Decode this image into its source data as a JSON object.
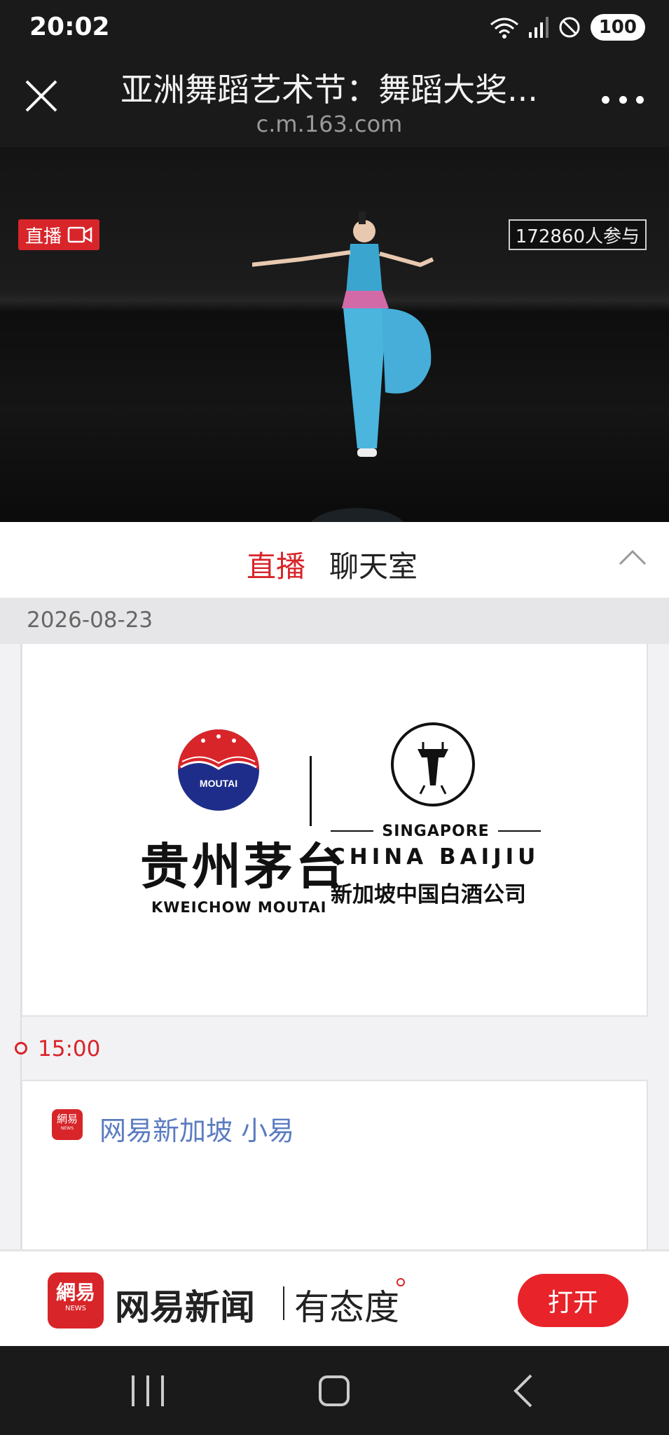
{
  "status_bar": {
    "time": "20:02",
    "network": "6E",
    "battery": "100",
    "icons": [
      "wifi-icon",
      "signal-icon",
      "do-not-disturb-icon",
      "battery-icon"
    ]
  },
  "browser": {
    "title": "亚洲舞蹈艺术节：舞蹈大奖...",
    "url": "c.m.163.com",
    "close_icon": "close-icon",
    "more_icon": "more-options-icon"
  },
  "video": {
    "live_label": "直播",
    "viewers": "172860人参与"
  },
  "tabs": {
    "live": "直播",
    "chat": "聊天室"
  },
  "feed": {
    "date": "2026-08-23",
    "ad_logos": {
      "moutai_emblem_text": "MOUTAI",
      "moutai_cn": "贵州茅台",
      "moutai_en": "KWEICHOW MOUTAI",
      "sg_label": "SINGAPORE",
      "baijiu_en": "CHINA BAIJIU",
      "baijiu_cn": "新加坡中国白酒公司"
    },
    "time": "15:00",
    "author": "网易新加坡 小易",
    "author_icon_text": "網易",
    "author_icon_sub": "NEWS"
  },
  "app_banner": {
    "logo_text": "網易",
    "logo_sub": "NEWS",
    "app_name": "网易新闻",
    "slogan": "有态度",
    "open_label": "打开"
  },
  "colors": {
    "accent_red": "#d8252a",
    "author_blue": "#5b7cc0",
    "dark_bg": "#1a1a1a"
  }
}
